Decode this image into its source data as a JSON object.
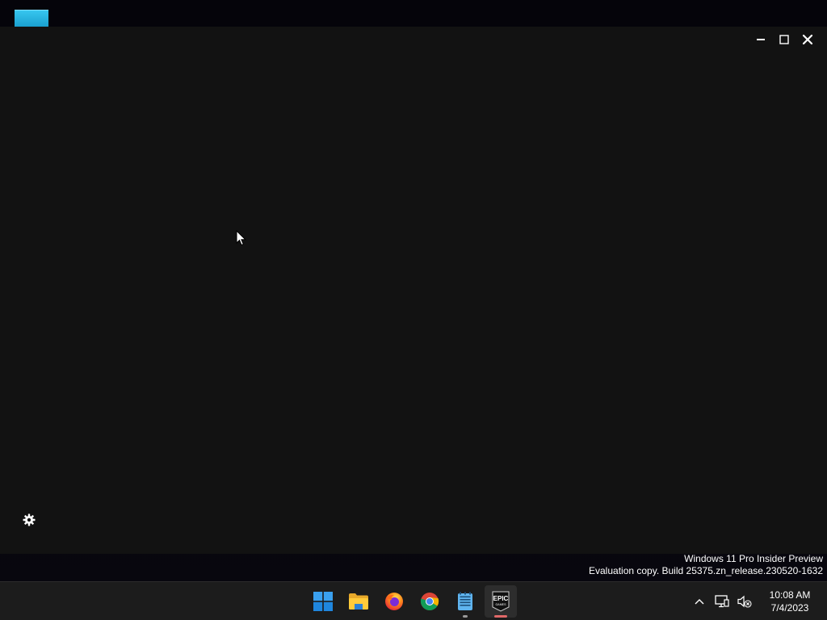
{
  "desktop": {
    "icon_color": "#2bb3e0"
  },
  "window": {
    "background": "#121212",
    "controls": [
      "minimize-icon",
      "maximize-icon",
      "close-icon"
    ],
    "settings_icon": "gear-icon"
  },
  "watermark": {
    "line1": "Windows 11 Pro Insider Preview",
    "line2": "Evaluation copy. Build 25375.zn_release.230520-1632"
  },
  "taskbar": {
    "apps": [
      {
        "name": "Start",
        "icon": "windows-start-icon"
      },
      {
        "name": "File Explorer",
        "icon": "folder-icon"
      },
      {
        "name": "Firefox",
        "icon": "firefox-icon"
      },
      {
        "name": "Google Chrome",
        "icon": "chrome-icon"
      },
      {
        "name": "Notepad",
        "icon": "notepad-icon",
        "running": true
      },
      {
        "name": "Epic Games Launcher",
        "icon": "epic-games-icon",
        "running": true,
        "focused": true,
        "label_top": "EPIC",
        "label_bottom": "GAMES"
      }
    ],
    "tray": {
      "icons": [
        "chevron-up-icon",
        "network-icon",
        "volume-muted-icon"
      ],
      "time": "10:08 AM",
      "date": "7/4/2023"
    }
  }
}
